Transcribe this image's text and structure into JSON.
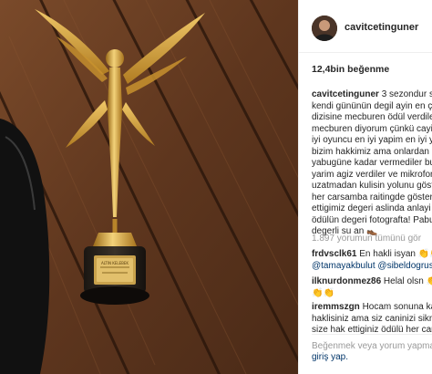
{
  "post": {
    "username": "cavitcetinguner",
    "likes": "12,4bin beğenme",
    "caption_lines": [
      "3 sezondur sa",
      "kendi gününün degil ayin en ç",
      "dizisine mecburen ödül verdile",
      "mecburen diyorum çünkü cayi",
      "iyi oyuncu en iyi yapim en iyi y",
      "bizim hakkimiz ama onlardan c",
      "yabugüne kadar vermediler bu",
      "yarim agiz verdiler ve mikrofon",
      "uzatmadan kulisin yolunu göst",
      "her carsamba raitingde gösteri",
      "ettigimiz degeri aslinda anlayi",
      "ödülün degeri fotografta! Pabu",
      "degerli su an"
    ],
    "caption_emoji": "👞"
  },
  "comments_link": "1.897 yorumun tümünü gör",
  "comments": [
    {
      "user": "frdvsclk61",
      "line1": " En hakli isyan ",
      "emoji": "👏👏",
      "line2_mentions": [
        "@tamayakbulut",
        "@sibeldogruso"
      ]
    },
    {
      "user": "ilknurdonmez86",
      "line1": " Helal olsn ",
      "emoji": "👏",
      "line2": "👏👏"
    },
    {
      "user": "iremmszgn",
      "line1": " Hocam sonuna kad",
      "line2": "haklisiniz ama siz caninizi sikm",
      "line3": "size hak ettiginiz ödülü her car"
    }
  ],
  "footer": {
    "add_comment": "Beğenmek veya yorum yapma",
    "login": "giriş yap."
  },
  "trophy": {
    "plaque_text": "ALTIN KELEBEK"
  },
  "colors": {
    "wood": "#6b3f22",
    "gold": "#d4a23c",
    "link": "#003569",
    "muted": "#999999"
  }
}
